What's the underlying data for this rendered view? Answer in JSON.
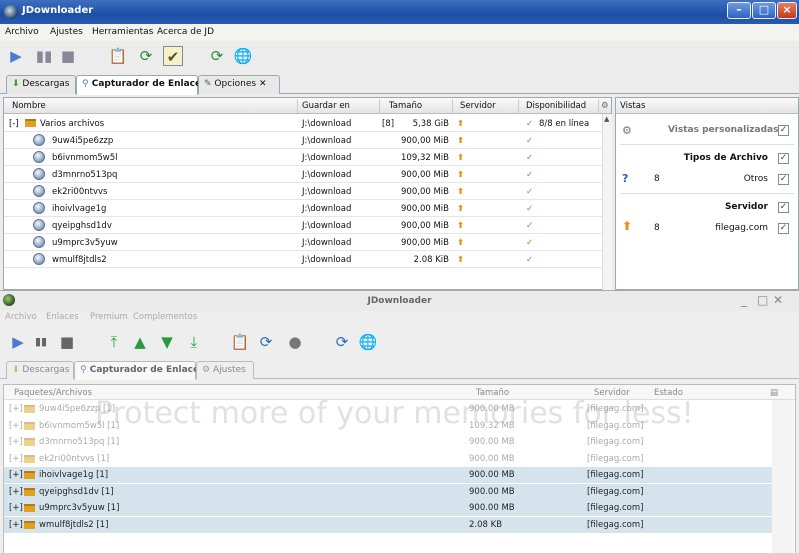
{
  "win1": {
    "title": "JDownloader",
    "menu": [
      "Archivo",
      "Ajustes",
      "Herramientas",
      "Acerca de JD"
    ],
    "tabs": [
      "Descargas",
      "Capturador de Enlaces",
      "Opciones"
    ],
    "columns": [
      "Nombre",
      "Guardar en",
      "Tamaño",
      "Servidor",
      "Disponibilidad"
    ],
    "group": {
      "toggle": "[-]",
      "name": "Varios archivos",
      "path": "J:\\download",
      "count": "[8]",
      "size": "5,38 GiB",
      "availability": "8/8 en línea"
    },
    "rows": [
      {
        "name": "9uw4i5pe6zzp",
        "path": "J:\\download",
        "size": "900,00 MiB"
      },
      {
        "name": "b6ivnmom5w5l",
        "path": "J:\\download",
        "size": "109,32 MiB"
      },
      {
        "name": "d3mnrno513pq",
        "path": "J:\\download",
        "size": "900,00 MiB"
      },
      {
        "name": "ek2ri00ntvvs",
        "path": "J:\\download",
        "size": "900,00 MiB"
      },
      {
        "name": "ihoivlvage1g",
        "path": "J:\\download",
        "size": "900,00 MiB"
      },
      {
        "name": "qyeipghsd1dv",
        "path": "J:\\download",
        "size": "900,00 MiB"
      },
      {
        "name": "u9mprc3v5yuw",
        "path": "J:\\download",
        "size": "900,00 MiB"
      },
      {
        "name": "wmulf8jtdls2",
        "path": "J:\\download",
        "size": "2.08 KiB"
      }
    ],
    "side": {
      "header": "Vistas",
      "custom_views": "Vistas personalizadas",
      "file_types": "Tipos de Archivo",
      "other_count": "8",
      "other_label": "Otros",
      "server": "Servidor",
      "host_count": "8",
      "host_label": "filegag.com"
    }
  },
  "win2": {
    "title": "JDownloader",
    "menu": [
      "Archivo",
      "Enlaces",
      "Premium",
      "Complementos"
    ],
    "tabs": [
      "Descargas",
      "Capturador de Enlaces",
      "Ajustes"
    ],
    "columns": [
      "Paquetes/Archivos",
      "Tamaño",
      "Servidor",
      "Estado"
    ],
    "rows": [
      {
        "toggle": "[+]",
        "name": "9uw4i5pe6zzp [1]",
        "size": "900.00 MB",
        "host": "[filegag.com]",
        "state": "dim"
      },
      {
        "toggle": "[+]",
        "name": "b6ivnmom5w5l [1]",
        "size": "109.32 MB",
        "host": "[filegag.com]",
        "state": "dim"
      },
      {
        "toggle": "[+]",
        "name": "d3mnrno513pq [1]",
        "size": "900.00 MB",
        "host": "[filegag.com]",
        "state": "dim"
      },
      {
        "toggle": "[+]",
        "name": "ek2ri00ntvvs [1]",
        "size": "900.00 MB",
        "host": "[filegag.com]",
        "state": "dim"
      },
      {
        "toggle": "[+]",
        "name": "ihoivlvage1g [1]",
        "size": "900.00 MB",
        "host": "[filegag.com]",
        "state": "sel"
      },
      {
        "toggle": "[+]",
        "name": "qyeipghsd1dv [1]",
        "size": "900.00 MB",
        "host": "[filegag.com]",
        "state": "sel"
      },
      {
        "toggle": "[+]",
        "name": "u9mprc3v5yuw [1]",
        "size": "900.00 MB",
        "host": "[filegag.com]",
        "state": "sel"
      },
      {
        "toggle": "[+]",
        "name": "wmulf8jtdls2 [1]",
        "size": "2.08 KB",
        "host": "[filegag.com]",
        "state": "sel"
      }
    ]
  },
  "watermark": "Protect more of your memories for less!",
  "icons": {
    "play": "play-icon",
    "pause": "pause-icon",
    "stop": "stop-icon",
    "clipboard": "clipboard-icon",
    "refresh": "refresh-icon",
    "globe": "globe-icon",
    "arrow_up": "host-arrow-icon",
    "check": "online-check-icon",
    "settings": "gear-icon"
  },
  "colors": {
    "titlebar": "#1c4fa6",
    "accent_arrow": "#f08a10",
    "online": "#4caf2a",
    "selection": "#d5e4ec"
  }
}
